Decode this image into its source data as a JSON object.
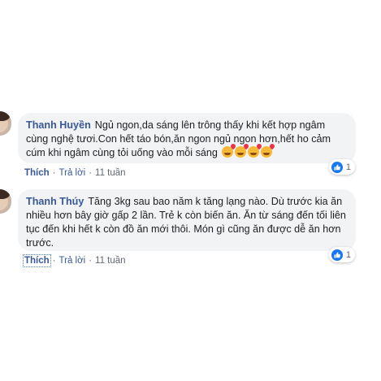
{
  "comments": [
    {
      "author": "Thanh Huyền",
      "text": "Ngủ ngon,da sáng lên trông thấy khi kết hợp ngâm cùng nghệ tươi.Con hết táo bón,ăn ngon ngủ ngon hơn,hết ho cảm cúm khi ngâm cùng tỏi uống vào mỗi sáng",
      "emoji_icon": "smiling-face-with-hearts-icon",
      "like_label": "Thích",
      "reply_label": "Trả lời",
      "time": "11 tuần",
      "reaction_count": "1"
    },
    {
      "author": "Thanh Thúy",
      "text": "Tăng 3kg sau bao năm k tăng lạng nào. Dù trước kia ăn nhiều hơn bây giờ gấp 2 lần. Trẻ k còn biến ăn. Ăn từ sáng đến tối liên tục đến khi hết k còn đồ ăn mới thôi. Món gì cũng ăn được dễ ăn hơn trước.",
      "like_label": "Thích",
      "reply_label": "Trả lời",
      "time": "11 tuần",
      "reaction_count": "1"
    }
  ],
  "separator": "·",
  "colors": {
    "bubble": "#f2f3f5",
    "author": "#385898",
    "meta": "#606770",
    "like_blue": "#1877f2"
  }
}
